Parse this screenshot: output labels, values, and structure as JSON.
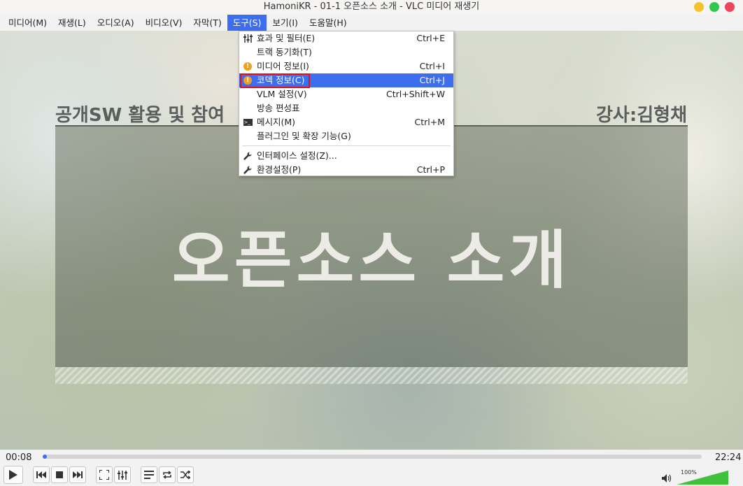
{
  "window": {
    "title": "HamoniKR - 01-1  오픈소스 소개 - VLC 미디어 재생기",
    "buttons": {
      "minimize_color": "#f5c12e",
      "maximize_color": "#32c84e",
      "close_color": "#f0445a"
    }
  },
  "menubar": [
    {
      "label": "미디어(M)"
    },
    {
      "label": "재생(L)"
    },
    {
      "label": "오디오(A)"
    },
    {
      "label": "비디오(V)"
    },
    {
      "label": "자막(T)"
    },
    {
      "label": "도구(S)",
      "active": true
    },
    {
      "label": "보기(I)"
    },
    {
      "label": "도움말(H)"
    }
  ],
  "tools_menu": {
    "items": [
      {
        "label": "효과 및 필터(E)",
        "shortcut": "Ctrl+E",
        "icon": "equalizer-icon"
      },
      {
        "label": "트랙 동기화(T)",
        "shortcut": "",
        "icon": ""
      },
      {
        "label": "미디어 정보(I)",
        "shortcut": "Ctrl+I",
        "icon": "info-icon"
      },
      {
        "label": "코덱 정보(C)",
        "shortcut": "Ctrl+J",
        "icon": "info-icon",
        "highlighted": true
      },
      {
        "label": "VLM 설정(V)",
        "shortcut": "Ctrl+Shift+W",
        "icon": ""
      },
      {
        "label": "방송 편성표",
        "shortcut": "",
        "icon": ""
      },
      {
        "label": "메시지(M)",
        "shortcut": "Ctrl+M",
        "icon": "terminal-icon"
      },
      {
        "label": "플러그인 및 확장 기능(G)",
        "shortcut": "",
        "icon": ""
      },
      {
        "label": "인터페이스 설정(Z)...",
        "shortcut": "",
        "icon": "wrench-icon"
      },
      {
        "label": "환경설정(P)",
        "shortcut": "Ctrl+P",
        "icon": "wrench-icon"
      }
    ],
    "highlight_color": "#3e6ef0",
    "annotation_box_color": "#e0101a"
  },
  "video": {
    "course_title": "공개SW 활용 및 참여",
    "lecturer": "강사:김형채",
    "main_title": "오픈소스 소개"
  },
  "controls": {
    "elapsed": "00:08",
    "total": "22:24",
    "progress_fraction": 0.006,
    "volume_label": "100%",
    "volume_fraction": 1.0,
    "buttons": [
      "play-icon",
      "previous-icon",
      "stop-icon",
      "next-icon",
      "fullscreen-icon",
      "extended-settings-icon",
      "playlist-icon",
      "loop-icon",
      "shuffle-icon"
    ]
  }
}
